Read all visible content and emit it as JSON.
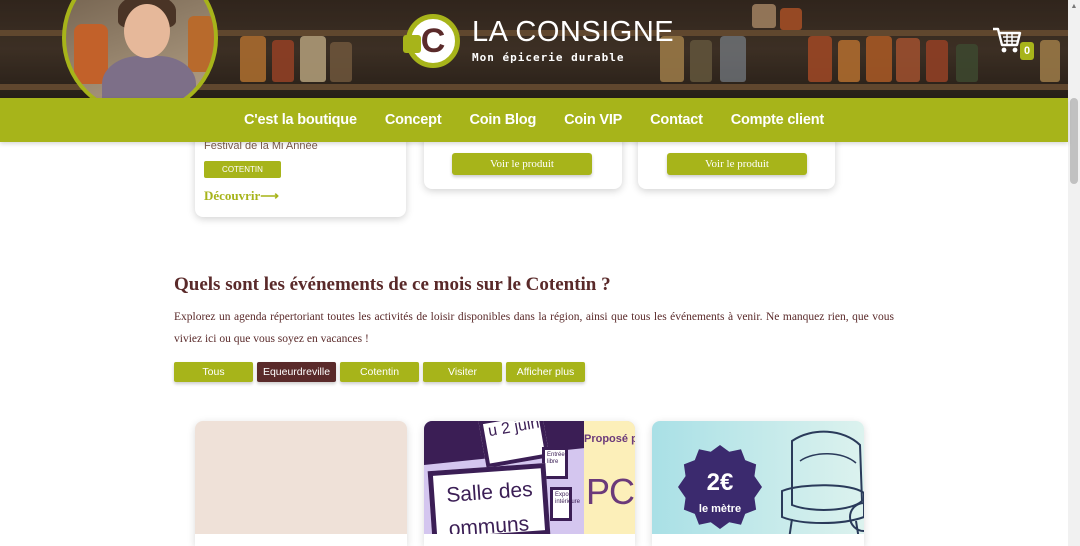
{
  "header": {
    "brand_name": "LA CONSIGNE",
    "brand_tagline": "Mon épicerie durable",
    "cart_count": "0",
    "cart_icon": "cart-icon"
  },
  "nav": {
    "items": [
      {
        "label": "C'est la boutique"
      },
      {
        "label": "Concept"
      },
      {
        "label": "Coin Blog"
      },
      {
        "label": "Coin VIP"
      },
      {
        "label": "Contact"
      },
      {
        "label": "Compte client"
      }
    ]
  },
  "top_cards": {
    "card1": {
      "subtitle": "Festival de la Mi Année",
      "tag": "COTENTIN",
      "link": "Découvrir⟶"
    },
    "card2": {
      "button": "Voir le produit"
    },
    "card3": {
      "button": "Voir le produit"
    }
  },
  "events_section": {
    "heading": "Quels sont les événements de ce mois sur le Cotentin ?",
    "description": "Explorez un agenda répertoriant toutes les activités de loisir disponibles dans la région, ainsi que tous les événements à venir. Ne manquez rien, que vous viviez ici ou que vous soyez en vacances !",
    "filters": [
      {
        "label": "Tous",
        "active": false
      },
      {
        "label": "Equeurdreville",
        "active": true
      },
      {
        "label": "Cotentin",
        "active": false
      },
      {
        "label": "Visiter",
        "active": false
      },
      {
        "label": "Afficher plus",
        "active": false
      }
    ]
  },
  "event_cards": {
    "card2": {
      "board_top": "u 2 juin",
      "board_main_1": "Salle des",
      "board_main_2": "ommuns",
      "side_sign_1": "Entrée libre",
      "side_sign_2": "Expo intérieure",
      "propose": "Proposé p",
      "big_text": "PCE"
    },
    "card3": {
      "price": "2€",
      "unit": "le mètre"
    }
  },
  "colors": {
    "accent_green": "#a7b41a",
    "brand_brown": "#5a2a2a"
  }
}
